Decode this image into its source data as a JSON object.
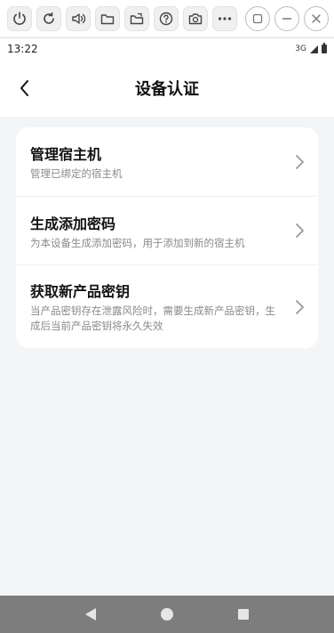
{
  "toolbar": {
    "buttons": [
      "power-icon",
      "refresh-icon",
      "volume-icon",
      "folder-icon",
      "clipboard-folder-icon",
      "help-icon",
      "camera-icon",
      "more-icon"
    ],
    "window_controls": [
      "restore-icon",
      "minimize-icon",
      "close-icon"
    ]
  },
  "status_bar": {
    "time": "13:22",
    "network": "3G"
  },
  "header": {
    "title": "设备认证"
  },
  "menu": {
    "items": [
      {
        "title": "管理宿主机",
        "description": "管理已绑定的宿主机"
      },
      {
        "title": "生成添加密码",
        "description": "为本设备生成添加密码，用于添加到新的宿主机"
      },
      {
        "title": "获取新产品密钥",
        "description": "当产品密钥存在泄露风险时，需要生成新产品密钥，生成后当前产品密钥将永久失效"
      }
    ]
  },
  "colors": {
    "background": "#f4f5f7",
    "card": "#ffffff",
    "nav_bar": "#7d7d7d"
  }
}
